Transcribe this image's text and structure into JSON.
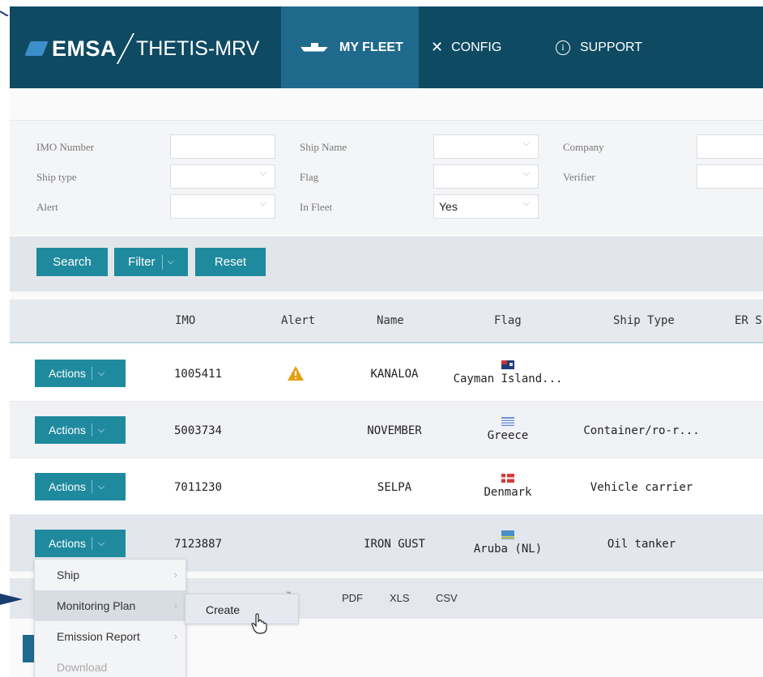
{
  "brand": {
    "name": "EMSA",
    "product": "THETIS-MRV"
  },
  "nav": [
    {
      "label": "MY FLEET",
      "icon": "ship-icon",
      "active": true
    },
    {
      "label": "CONFIG",
      "icon": "tools-icon"
    },
    {
      "label": "SUPPORT",
      "icon": "info-icon"
    }
  ],
  "filters": {
    "imo_label": "IMO Number",
    "imo_value": "",
    "ship_name_label": "Ship Name",
    "ship_name_value": "",
    "company_label": "Company",
    "company_value": "",
    "ship_type_label": "Ship type",
    "ship_type_value": "",
    "flag_label": "Flag",
    "flag_value": "",
    "verifier_label": "Verifier",
    "verifier_value": "",
    "alert_label": "Alert",
    "alert_value": "",
    "in_fleet_label": "In Fleet",
    "in_fleet_value": "Yes"
  },
  "buttons": {
    "search": "Search",
    "filter": "Filter",
    "reset": "Reset"
  },
  "table": {
    "headers": [
      "IMO",
      "Alert",
      "Name",
      "Flag",
      "Ship Type",
      "ER S"
    ],
    "actions_label": "Actions",
    "rows": [
      {
        "imo": "1005411",
        "alert": true,
        "name": "KANALOA",
        "flag": "Cayman Island...",
        "ship_type": ""
      },
      {
        "imo": "5003734",
        "alert": false,
        "name": "NOVEMBER",
        "flag": "Greece",
        "ship_type": "Container/ro-r..."
      },
      {
        "imo": "7011230",
        "alert": false,
        "name": "SELPA",
        "flag": "Denmark",
        "ship_type": "Vehicle carrier"
      },
      {
        "imo": "7123887",
        "alert": false,
        "name": "IRON GUST",
        "flag": "Aruba (NL)",
        "ship_type": "Oil tanker"
      }
    ]
  },
  "pagination": {
    "pdf": "PDF",
    "xls": "XLS",
    "csv": "CSV"
  },
  "actions_menu": {
    "items": [
      "Ship",
      "Monitoring Plan",
      "Emission Report",
      "Download"
    ],
    "submenu": "Create"
  },
  "colors": {
    "topbar": "#0f4a63",
    "active_tab": "#1f6a8c",
    "button": "#1f8a9e",
    "arrow": "#173d6e"
  }
}
